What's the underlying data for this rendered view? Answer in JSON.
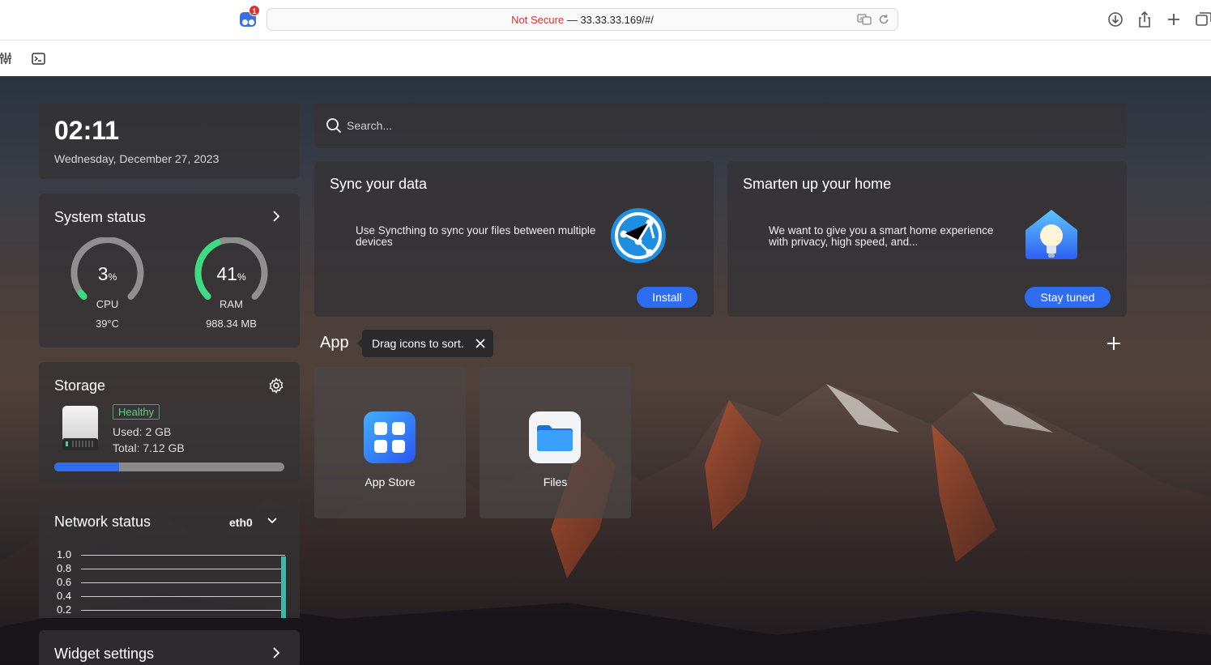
{
  "browser": {
    "extension_badge_count": "1",
    "url_insecure_label": "Not Secure",
    "url_separator": " — ",
    "url_address": "33.33.33.169/#/",
    "icons": [
      "extension-icon",
      "translate-icon",
      "reload-icon",
      "download-icon",
      "share-icon",
      "new-tab-icon",
      "tabs-overview-icon",
      "sliders-icon",
      "terminal-icon"
    ]
  },
  "clock": {
    "time": "02:11",
    "date": "Wednesday, December 27, 2023"
  },
  "system_status": {
    "title": "System status",
    "cpu": {
      "value": "3",
      "percent": 3,
      "unit": "%",
      "label": "CPU",
      "detail": "39°C"
    },
    "ram": {
      "value": "41",
      "percent": 41,
      "unit": "%",
      "label": "RAM",
      "detail": "988.34 MB"
    },
    "colors": {
      "gauge_track": "#8f8f8f",
      "gauge_fill": "#3ddc84"
    }
  },
  "storage": {
    "title": "Storage",
    "status": "Healthy",
    "used": "Used: 2 GB",
    "total": "Total: 7.12 GB",
    "used_fraction": 0.28,
    "colors": {
      "progress": "#2f6df0",
      "healthy": "#3fae6a"
    }
  },
  "network": {
    "title": "Network status",
    "interface": "eth0",
    "y_ticks": [
      "1.0",
      "0.8",
      "0.6",
      "0.4",
      "0.2"
    ]
  },
  "widget_settings": {
    "title": "Widget settings"
  },
  "search": {
    "placeholder": "Search..."
  },
  "promos": [
    {
      "title": "Sync your data",
      "description": "Use Syncthing to sync your files between multiple devices",
      "button": "Install"
    },
    {
      "title": "Smarten up your home",
      "description": "We want to give you a smart home experience with privacy, high speed, and...",
      "button": "Stay tuned"
    }
  ],
  "apps_section": {
    "title": "App",
    "tooltip": "Drag icons to sort.",
    "apps": [
      {
        "name": "App Store"
      },
      {
        "name": "Files"
      }
    ]
  },
  "accent_color": "#2f6df0"
}
